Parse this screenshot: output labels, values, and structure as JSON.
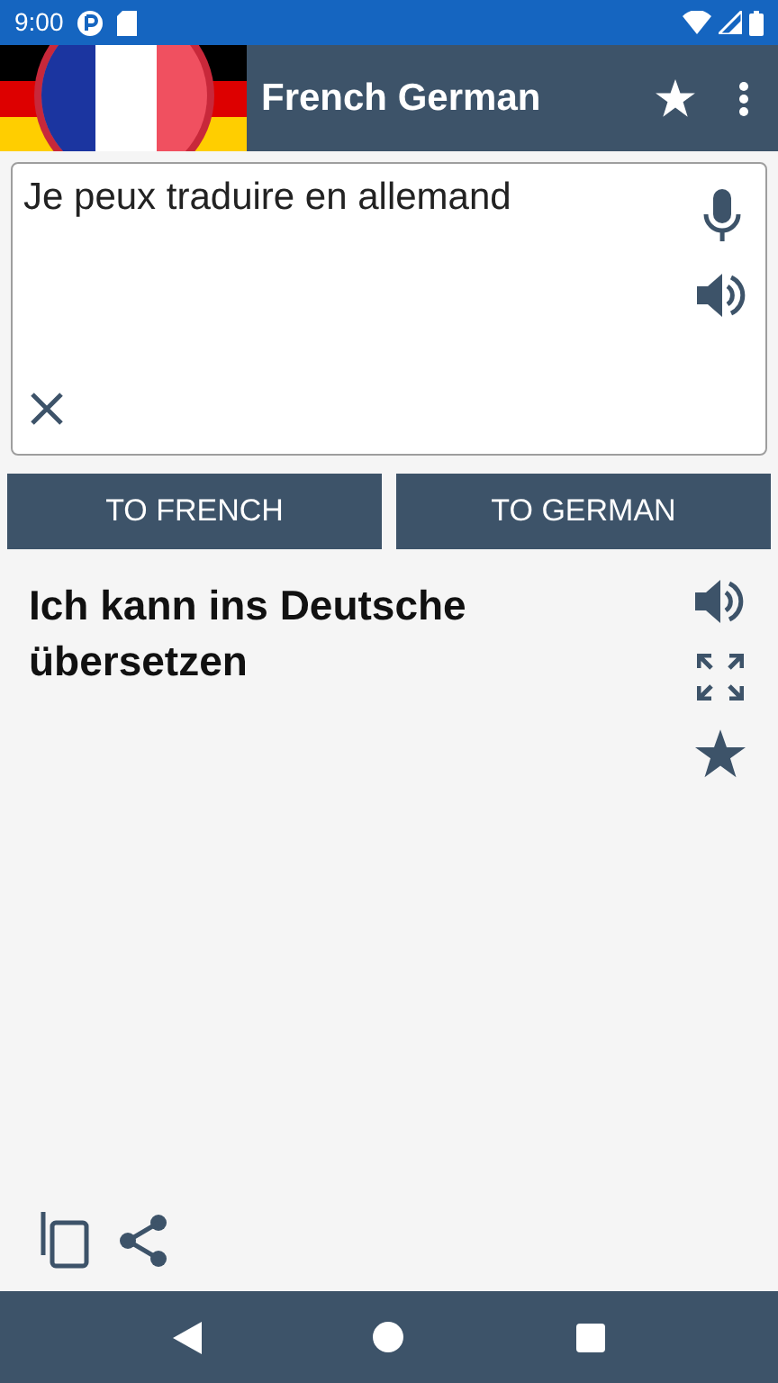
{
  "status_bar": {
    "time": "9:00"
  },
  "app_bar": {
    "title": "French German"
  },
  "input": {
    "value": "Je peux traduire en allemand"
  },
  "buttons": [
    {
      "label": "TO FRENCH"
    },
    {
      "label": "TO GERMAN"
    }
  ],
  "result": {
    "text": "Ich kann ins Deutsche übersetzen"
  }
}
